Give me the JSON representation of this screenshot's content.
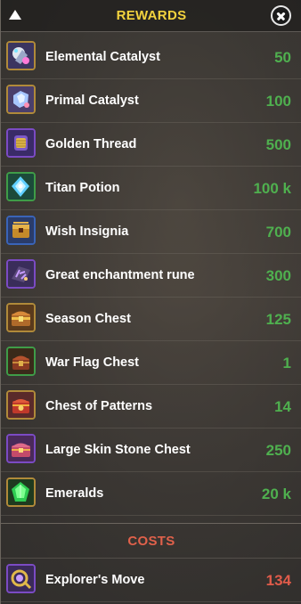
{
  "header": {
    "title": "REWARDS"
  },
  "rewards": [
    {
      "name": "Elemental Catalyst",
      "qty": "50",
      "icon": "elemental-catalyst-icon",
      "border": "#b08a3a"
    },
    {
      "name": "Primal Catalyst",
      "qty": "100",
      "icon": "primal-catalyst-icon",
      "border": "#b08a3a"
    },
    {
      "name": "Golden Thread",
      "qty": "500",
      "icon": "golden-thread-icon",
      "border": "#7b4bc4"
    },
    {
      "name": "Titan Potion",
      "qty": "100 k",
      "icon": "titan-potion-icon",
      "border": "#3f9c48"
    },
    {
      "name": "Wish Insignia",
      "qty": "700",
      "icon": "wish-insignia-icon",
      "border": "#3a64b8"
    },
    {
      "name": "Great enchantment rune",
      "qty": "300",
      "icon": "enchantment-rune-icon",
      "border": "#7b4bc4"
    },
    {
      "name": "Season Chest",
      "qty": "125",
      "icon": "season-chest-icon",
      "border": "#b08a3a"
    },
    {
      "name": "War Flag Chest",
      "qty": "1",
      "icon": "war-flag-chest-icon",
      "border": "#3f9c48"
    },
    {
      "name": "Chest of Patterns",
      "qty": "14",
      "icon": "chest-of-patterns-icon",
      "border": "#b08a3a"
    },
    {
      "name": "Large Skin Stone Chest",
      "qty": "250",
      "icon": "skin-stone-chest-icon",
      "border": "#7b4bc4"
    },
    {
      "name": "Emeralds",
      "qty": "20 k",
      "icon": "emerald-icon",
      "border": "#b08a3a"
    }
  ],
  "costs": {
    "title": "COSTS",
    "items": [
      {
        "name": "Explorer's Move",
        "qty": "134",
        "icon": "explorers-move-icon",
        "border": "#7b4bc4"
      }
    ]
  },
  "colors": {
    "title": "#f3d33e",
    "reward_qty": "#4fb04f",
    "cost_qty": "#e05b4a",
    "costs_title": "#e0614b"
  }
}
